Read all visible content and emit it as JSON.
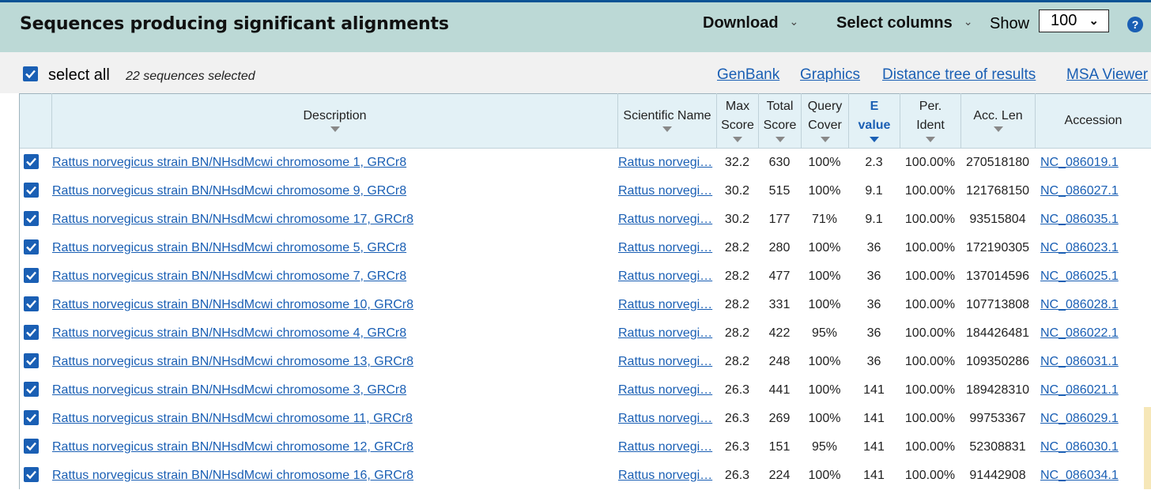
{
  "header": {
    "title": "Sequences producing significant alignments",
    "download_label": "Download",
    "select_columns_label": "Select columns",
    "show_label": "Show",
    "show_value": "100",
    "help_label": "?"
  },
  "subbar": {
    "select_all_label": "select all",
    "selected_count": "22 sequences selected",
    "links": [
      "GenBank",
      "Graphics",
      "Distance tree of results",
      "MSA Viewer"
    ]
  },
  "columns": {
    "description": "Description",
    "scientific_name": "Scientific Name",
    "max_score": [
      "Max",
      "Score"
    ],
    "total_score": [
      "Total",
      "Score"
    ],
    "query_cover": [
      "Query",
      "Cover"
    ],
    "e_value": [
      "E",
      "value"
    ],
    "per_ident": [
      "Per.",
      "Ident"
    ],
    "acc_len": "Acc. Len",
    "accession": "Accession"
  },
  "rows": [
    {
      "description": "Rattus norvegicus strain BN/NHsdMcwi chromosome 1, GRCr8",
      "sci": "Rattus norvegi…",
      "max": "32.2",
      "total": "630",
      "cover": "100%",
      "evalue": "2.3",
      "ident": "100.00%",
      "acclen": "270518180",
      "acc": "NC_086019.1"
    },
    {
      "description": "Rattus norvegicus strain BN/NHsdMcwi chromosome 9, GRCr8",
      "sci": "Rattus norvegi…",
      "max": "30.2",
      "total": "515",
      "cover": "100%",
      "evalue": "9.1",
      "ident": "100.00%",
      "acclen": "121768150",
      "acc": "NC_086027.1"
    },
    {
      "description": "Rattus norvegicus strain BN/NHsdMcwi chromosome 17, GRCr8",
      "sci": "Rattus norvegi…",
      "max": "30.2",
      "total": "177",
      "cover": "71%",
      "evalue": "9.1",
      "ident": "100.00%",
      "acclen": "93515804",
      "acc": "NC_086035.1"
    },
    {
      "description": "Rattus norvegicus strain BN/NHsdMcwi chromosome 5, GRCr8",
      "sci": "Rattus norvegi…",
      "max": "28.2",
      "total": "280",
      "cover": "100%",
      "evalue": "36",
      "ident": "100.00%",
      "acclen": "172190305",
      "acc": "NC_086023.1"
    },
    {
      "description": "Rattus norvegicus strain BN/NHsdMcwi chromosome 7, GRCr8",
      "sci": "Rattus norvegi…",
      "max": "28.2",
      "total": "477",
      "cover": "100%",
      "evalue": "36",
      "ident": "100.00%",
      "acclen": "137014596",
      "acc": "NC_086025.1"
    },
    {
      "description": "Rattus norvegicus strain BN/NHsdMcwi chromosome 10, GRCr8",
      "sci": "Rattus norvegi…",
      "max": "28.2",
      "total": "331",
      "cover": "100%",
      "evalue": "36",
      "ident": "100.00%",
      "acclen": "107713808",
      "acc": "NC_086028.1"
    },
    {
      "description": "Rattus norvegicus strain BN/NHsdMcwi chromosome 4, GRCr8",
      "sci": "Rattus norvegi…",
      "max": "28.2",
      "total": "422",
      "cover": "95%",
      "evalue": "36",
      "ident": "100.00%",
      "acclen": "184426481",
      "acc": "NC_086022.1"
    },
    {
      "description": "Rattus norvegicus strain BN/NHsdMcwi chromosome 13, GRCr8",
      "sci": "Rattus norvegi…",
      "max": "28.2",
      "total": "248",
      "cover": "100%",
      "evalue": "36",
      "ident": "100.00%",
      "acclen": "109350286",
      "acc": "NC_086031.1"
    },
    {
      "description": "Rattus norvegicus strain BN/NHsdMcwi chromosome 3, GRCr8",
      "sci": "Rattus norvegi…",
      "max": "26.3",
      "total": "441",
      "cover": "100%",
      "evalue": "141",
      "ident": "100.00%",
      "acclen": "189428310",
      "acc": "NC_086021.1"
    },
    {
      "description": "Rattus norvegicus strain BN/NHsdMcwi chromosome 11, GRCr8",
      "sci": "Rattus norvegi…",
      "max": "26.3",
      "total": "269",
      "cover": "100%",
      "evalue": "141",
      "ident": "100.00%",
      "acclen": "99753367",
      "acc": "NC_086029.1"
    },
    {
      "description": "Rattus norvegicus strain BN/NHsdMcwi chromosome 12, GRCr8",
      "sci": "Rattus norvegi…",
      "max": "26.3",
      "total": "151",
      "cover": "95%",
      "evalue": "141",
      "ident": "100.00%",
      "acclen": "52308831",
      "acc": "NC_086030.1"
    },
    {
      "description": "Rattus norvegicus strain BN/NHsdMcwi chromosome 16, GRCr8",
      "sci": "Rattus norvegi…",
      "max": "26.3",
      "total": "224",
      "cover": "100%",
      "evalue": "141",
      "ident": "100.00%",
      "acclen": "91442908",
      "acc": "NC_086034.1"
    }
  ],
  "colors": {
    "header_bg": "#bcd9d6",
    "table_header_bg": "#e3f1f6",
    "link": "#1a5fb4",
    "checkbox": "#1a5fb4"
  }
}
